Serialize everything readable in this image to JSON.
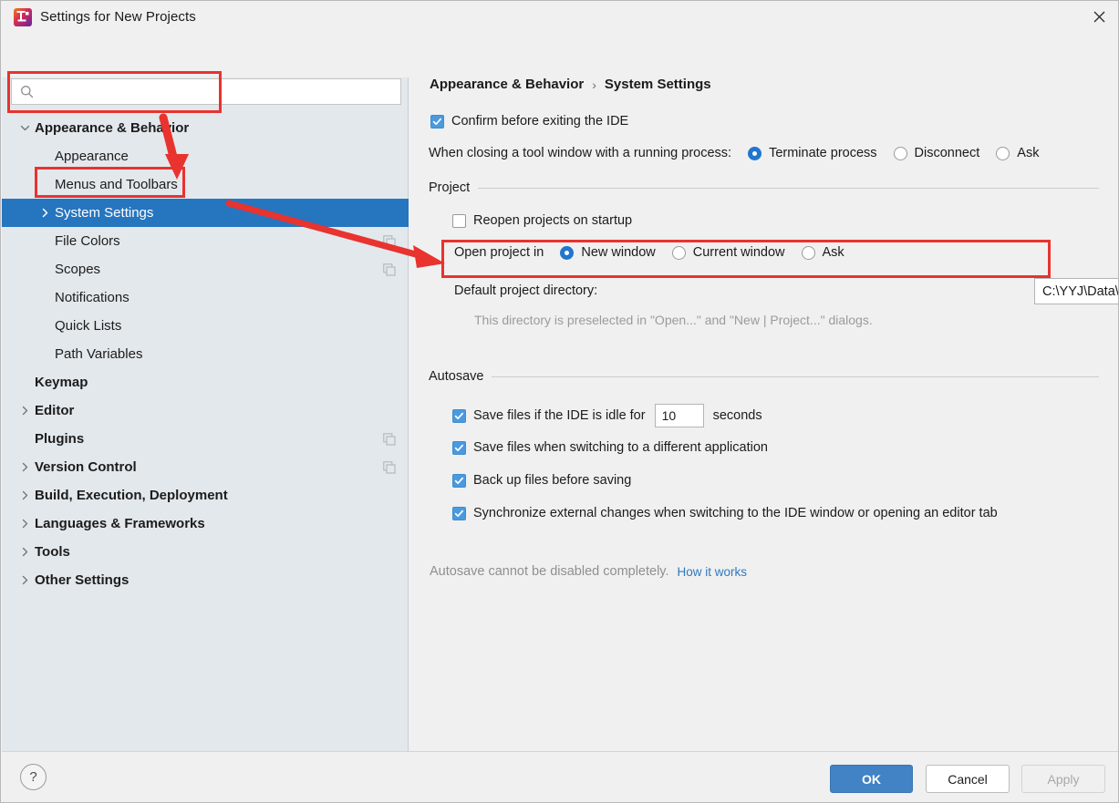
{
  "window": {
    "title": "Settings for New Projects",
    "app_icon": "intellij-idea-icon",
    "close_icon": "close-icon"
  },
  "sidebar": {
    "search": {
      "value": "",
      "placeholder": "",
      "icon": "search-icon"
    },
    "items": [
      {
        "label": "Appearance & Behavior",
        "depth": 0,
        "bold": true,
        "twisty": "chevron-down-icon",
        "selected": false,
        "copy_icon": false
      },
      {
        "label": "Appearance",
        "depth": 1,
        "bold": false,
        "twisty": "",
        "selected": false,
        "copy_icon": false
      },
      {
        "label": "Menus and Toolbars",
        "depth": 1,
        "bold": false,
        "twisty": "",
        "selected": false,
        "copy_icon": false
      },
      {
        "label": "System Settings",
        "depth": 1,
        "bold": false,
        "twisty": "chevron-right-icon",
        "selected": true,
        "copy_icon": false
      },
      {
        "label": "File Colors",
        "depth": 1,
        "bold": false,
        "twisty": "",
        "selected": false,
        "copy_icon": true
      },
      {
        "label": "Scopes",
        "depth": 1,
        "bold": false,
        "twisty": "",
        "selected": false,
        "copy_icon": true
      },
      {
        "label": "Notifications",
        "depth": 1,
        "bold": false,
        "twisty": "",
        "selected": false,
        "copy_icon": false
      },
      {
        "label": "Quick Lists",
        "depth": 1,
        "bold": false,
        "twisty": "",
        "selected": false,
        "copy_icon": false
      },
      {
        "label": "Path Variables",
        "depth": 1,
        "bold": false,
        "twisty": "",
        "selected": false,
        "copy_icon": false
      },
      {
        "label": "Keymap",
        "depth": 0,
        "bold": true,
        "twisty": "",
        "selected": false,
        "copy_icon": false
      },
      {
        "label": "Editor",
        "depth": 0,
        "bold": true,
        "twisty": "chevron-right-icon",
        "selected": false,
        "copy_icon": false
      },
      {
        "label": "Plugins",
        "depth": 0,
        "bold": true,
        "twisty": "",
        "selected": false,
        "copy_icon": true
      },
      {
        "label": "Version Control",
        "depth": 0,
        "bold": true,
        "twisty": "chevron-right-icon",
        "selected": false,
        "copy_icon": true
      },
      {
        "label": "Build, Execution, Deployment",
        "depth": 0,
        "bold": true,
        "twisty": "chevron-right-icon",
        "selected": false,
        "copy_icon": false
      },
      {
        "label": "Languages & Frameworks",
        "depth": 0,
        "bold": true,
        "twisty": "chevron-right-icon",
        "selected": false,
        "copy_icon": false
      },
      {
        "label": "Tools",
        "depth": 0,
        "bold": true,
        "twisty": "chevron-right-icon",
        "selected": false,
        "copy_icon": false
      },
      {
        "label": "Other Settings",
        "depth": 0,
        "bold": true,
        "twisty": "chevron-right-icon",
        "selected": false,
        "copy_icon": false
      }
    ]
  },
  "main": {
    "breadcrumb": {
      "parent": "Appearance & Behavior",
      "separator": "›",
      "current": "System Settings"
    },
    "confirm_exit": {
      "label": "Confirm before exiting the IDE",
      "checked": true
    },
    "tool_window": {
      "label": "When closing a tool window with a running process:",
      "options": [
        {
          "label": "Terminate process",
          "selected": true
        },
        {
          "label": "Disconnect",
          "selected": false
        },
        {
          "label": "Ask",
          "selected": false
        }
      ]
    },
    "project": {
      "group_title": "Project",
      "reopen": {
        "label": "Reopen projects on startup",
        "checked": false
      },
      "open_in": {
        "label": "Open project in",
        "options": [
          {
            "label": "New window",
            "selected": true
          },
          {
            "label": "Current window",
            "selected": false
          },
          {
            "label": "Ask",
            "selected": false
          }
        ]
      },
      "default_dir": {
        "label": "Default project directory:",
        "value": "C:\\YYJ\\Data\\IDEA_WORKSPACE",
        "browse_icon": "folder-icon",
        "hint": "This directory is preselected in \"Open...\" and \"New | Project...\" dialogs."
      }
    },
    "autosave": {
      "group_title": "Autosave",
      "idle": {
        "label_before": "Save files if the IDE is idle for",
        "seconds": "10",
        "label_after": "seconds",
        "checked": true
      },
      "items": [
        {
          "label": "Save files when switching to a different application",
          "checked": true
        },
        {
          "label": "Back up files before saving",
          "checked": true
        },
        {
          "label": "Synchronize external changes when switching to the IDE window or opening an editor tab",
          "checked": true
        }
      ],
      "note": "Autosave cannot be disabled completely.",
      "note_link": "How it works"
    }
  },
  "footer": {
    "help_label": "?",
    "ok_label": "OK",
    "cancel_label": "Cancel",
    "apply_label": "Apply"
  },
  "colors": {
    "selection_blue": "#2675bf",
    "accent_blue": "#4a9ae0",
    "radio_blue": "#2176cd",
    "annotation_red": "#e8332f",
    "link_blue": "#2f79c0",
    "sidebar_bg": "#e3e8ec",
    "panel_bg": "#f0f0f0"
  }
}
